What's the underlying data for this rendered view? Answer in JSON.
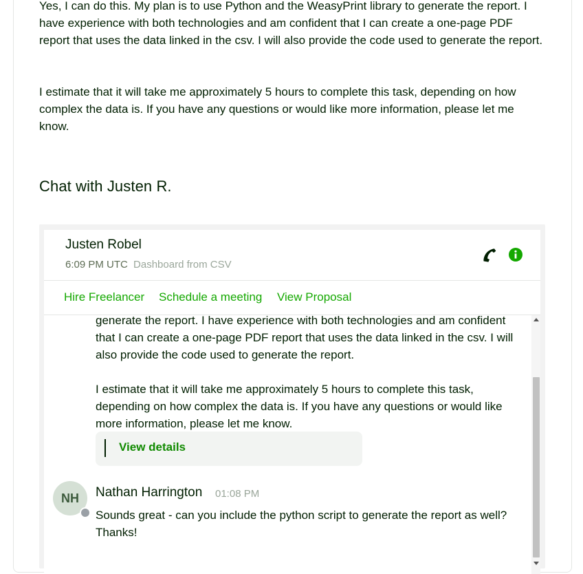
{
  "proposal": {
    "paragraph1": "Yes, I can do this. My plan is to use Python and the WeasyPrint library to generate the report. I have experience with both technologies and am confident that I can create a one-page PDF report that uses the data linked in the csv. I will also provide the code used to generate the report.",
    "paragraph2": "I estimate that it will take me approximately 5 hours to complete this task, depending on how complex the data is. If you have any questions or would like more information, please let me know."
  },
  "chat": {
    "heading": "Chat with Justen R.",
    "contact_name": "Justen Robel",
    "contact_time": "6:09 PM UTC",
    "contact_topic": "Dashboard from CSV",
    "icons": {
      "call": "phone-icon",
      "info": "info-icon"
    },
    "actions": {
      "hire": "Hire Freelancer",
      "schedule": "Schedule a meeting",
      "proposal": "View Proposal"
    },
    "messages": {
      "message1_tail": "generate the report. I have experience with both technologies and am confident that I can create a one-page PDF report that uses the data linked in the csv. I will also provide the code used to generate the report.",
      "message1_end": "I estimate that it will take me approximately 5 hours to complete this task, depending on how complex the data is. If you have any questions or would like more information, please let me know.",
      "view_details": "View details",
      "reply": {
        "initials": "NH",
        "sender": "Nathan Harrington",
        "time": "01:08 PM",
        "text": "Sounds great - can you include the python script to generate the report as well? Thanks!"
      }
    }
  },
  "colors": {
    "brand_green": "#14a800",
    "text_dark": "#001e00",
    "muted": "#5e6d55"
  }
}
